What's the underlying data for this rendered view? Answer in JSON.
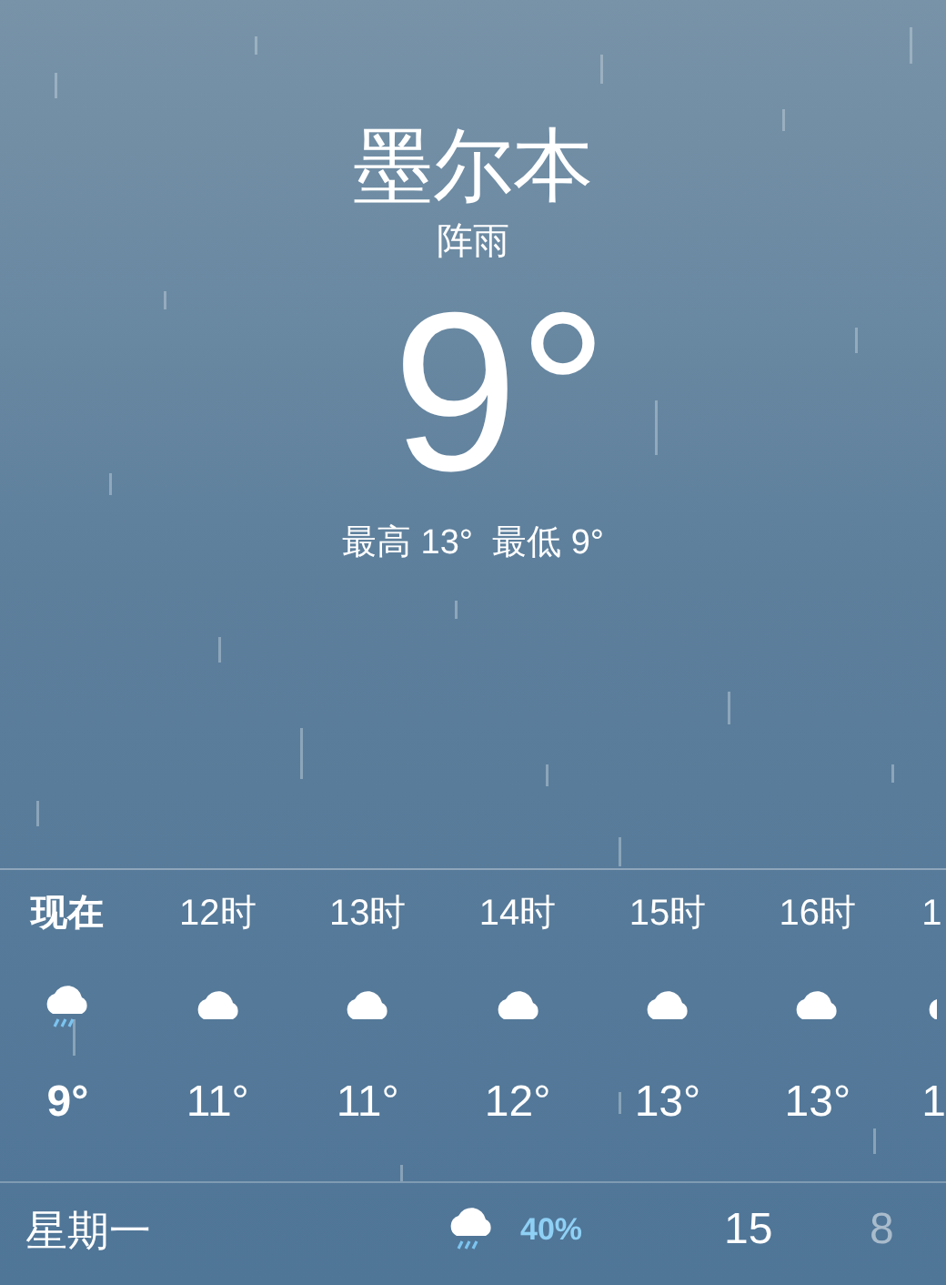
{
  "city": "墨尔本",
  "condition": "阵雨",
  "temperature": "9°",
  "high_low": "最高 13°  最低 9°",
  "hourly": [
    {
      "time": "现在",
      "kind": "rain",
      "temp": "9°",
      "selected": true
    },
    {
      "time": "12时",
      "kind": "cloud",
      "temp": "11°",
      "selected": false
    },
    {
      "time": "13时",
      "kind": "cloud",
      "temp": "11°",
      "selected": false
    },
    {
      "time": "14时",
      "kind": "cloud",
      "temp": "12°",
      "selected": false
    },
    {
      "time": "15时",
      "kind": "cloud",
      "temp": "13°",
      "selected": false
    },
    {
      "time": "16时",
      "kind": "cloud",
      "temp": "13°",
      "selected": false
    },
    {
      "time": "1",
      "kind": "cloud",
      "temp": "1",
      "selected": false
    }
  ],
  "daily": [
    {
      "day": "星期一",
      "kind": "rain",
      "chance": "40%",
      "high": "15",
      "low": "8"
    }
  ]
}
